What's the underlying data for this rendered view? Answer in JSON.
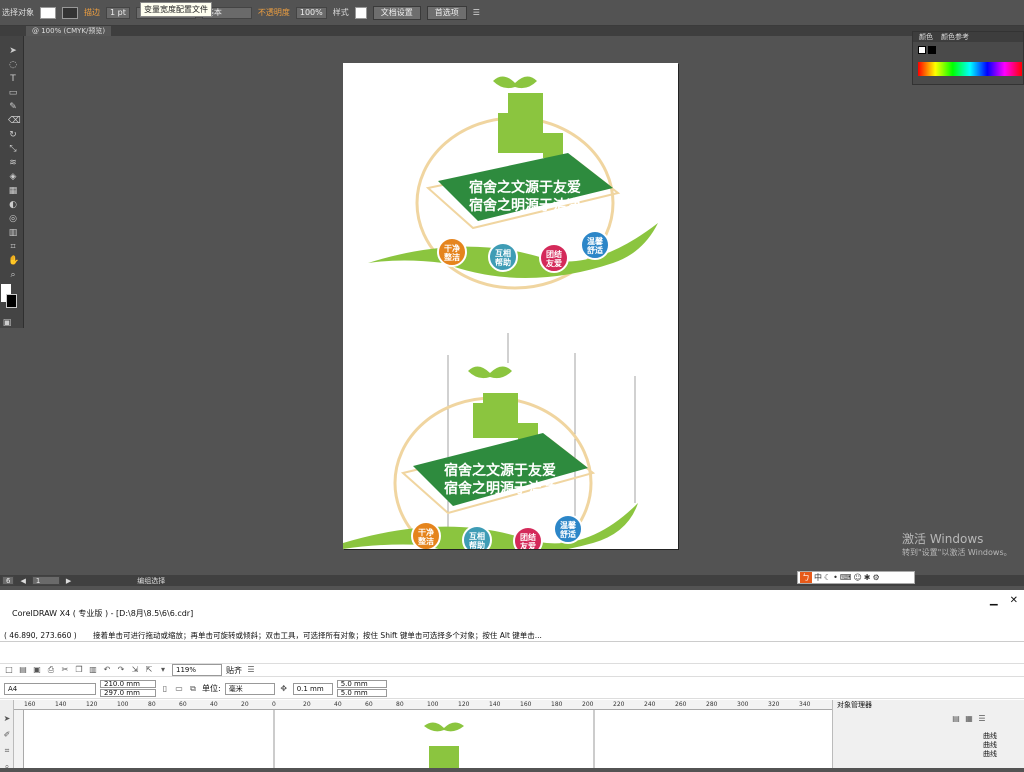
{
  "illustrator": {
    "control_bar": {
      "selection_label": "选择对象",
      "stroke_label": "描边",
      "stroke_weight": "1 pt",
      "stroke_style": "基本",
      "opacity_label": "不透明度",
      "opacity_value": "100%",
      "style_label": "样式",
      "doc_setup_button": "文档设置",
      "preferences_button": "首选项",
      "tooltip": "变量宽度配置文件"
    },
    "doc_tab": "@ 100% (CMYK/预览)",
    "color_panel": {
      "tab_color": "颜色",
      "tab_color_guide": "颜色参考"
    },
    "status_bar": {
      "zoom": "6",
      "page": "1",
      "mode": "编组选择"
    }
  },
  "artwork": {
    "slogan_line1": "宿舍之文源于友爱",
    "slogan_line2": "宿舍之明源于洁净",
    "badges": [
      {
        "line1": "干净",
        "line2": "整洁",
        "color": "#e5841d"
      },
      {
        "line1": "互相",
        "line2": "帮助",
        "color": "#3e9cb5"
      },
      {
        "line1": "团结",
        "line2": "友爱",
        "color": "#d42a5a"
      },
      {
        "line1": "温馨",
        "line2": "舒适",
        "color": "#2c86c8"
      }
    ],
    "colors": {
      "green_dark": "#2e8b3e",
      "green_light": "#8bc53f",
      "ring": "#f0d5a0"
    }
  },
  "windows_activation": {
    "line1": "激活 Windows",
    "line2": "转到\"设置\"以激活 Windows。"
  },
  "ime_bar": {
    "logo": "ㄅ",
    "mode": "中"
  },
  "coreldraw": {
    "title": "CorelDRAW X4 ( 专业版 ) - [D:\\8月\\8.5\\6\\6.cdr]",
    "hint_coords": "( 46.890, 273.660 )",
    "hint_text": "接着单击可进行拖动或缩放；再单击可旋转或倾斜；双击工具，可选择所有对象；按住 Shift 键单击可选择多个对象；按住 Alt 键单击...",
    "zoom": "119%",
    "snap_label": "贴齐",
    "page_size": "A4",
    "width": "210.0 mm",
    "height": "297.0 mm",
    "units_label": "单位:",
    "units_value": "毫米",
    "nudge": "0.1 mm",
    "dup_x": "5.0 mm",
    "dup_y": "5.0 mm",
    "object_manager": "对象管理器",
    "objects": [
      "曲线",
      "曲线",
      "曲线"
    ],
    "ruler_ticks": [
      "160",
      "140",
      "120",
      "100",
      "80",
      "60",
      "40",
      "20",
      "0",
      "20",
      "40",
      "60",
      "80",
      "100",
      "120",
      "140",
      "160",
      "180",
      "200",
      "220",
      "240",
      "260",
      "280",
      "300",
      "320",
      "340"
    ]
  }
}
